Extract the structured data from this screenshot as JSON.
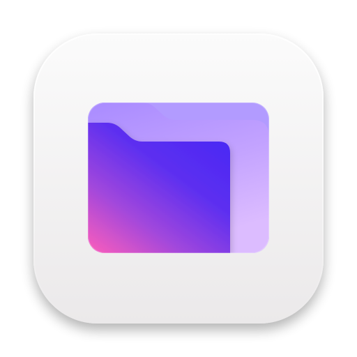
{
  "icon": {
    "name": "folder-app-icon",
    "glyph": "folder-icon",
    "colors": {
      "tile_top": "#fbfbfb",
      "tile_bottom": "#ebe9ea",
      "back_folder_top": "#a98bff",
      "back_folder_bottom": "#dcbcff",
      "front_folder_top": "#4b29f4",
      "front_folder_mid": "#7b3ae6",
      "front_folder_bottom": "#f05bbf",
      "shadow": "#7a7a7a"
    }
  }
}
